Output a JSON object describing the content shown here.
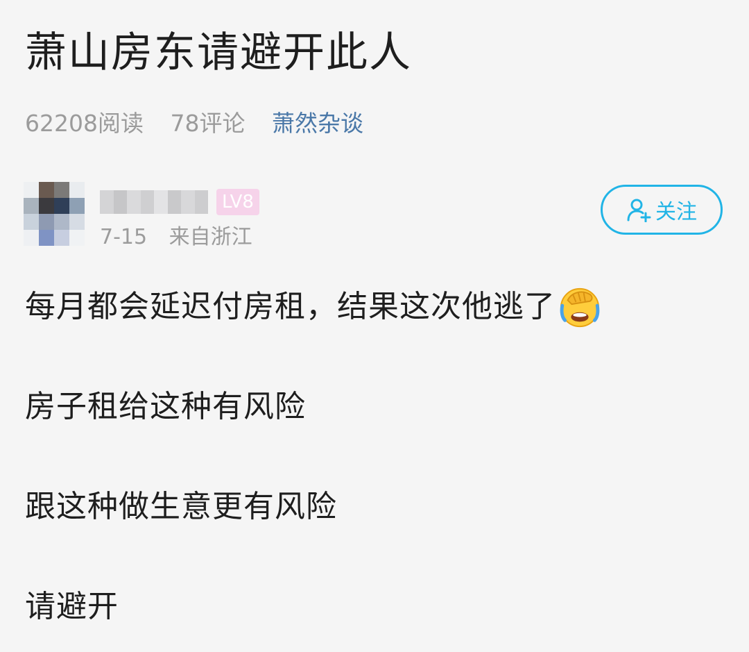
{
  "post": {
    "title": "萧山房东请避开此人",
    "views": "62208阅读",
    "comments": "78评论",
    "topic": "萧然杂谈"
  },
  "author": {
    "level": "LV8",
    "date": "7-15",
    "location": "来自浙江",
    "follow_label": "关注"
  },
  "content": {
    "paragraphs": [
      "每月都会延迟付房租，结果这次他逃了",
      "房子租给这种有风险",
      "跟这种做生意更有风险",
      "请避开"
    ],
    "emoji_name": "facepalm-laugh-cry-emoji"
  },
  "colors": {
    "accent": "#21b4e6",
    "topic_link": "#4a78a8",
    "level_badge": "#f6d3ea",
    "meta_text": "#9b9b9b",
    "background": "#f5f5f5"
  }
}
